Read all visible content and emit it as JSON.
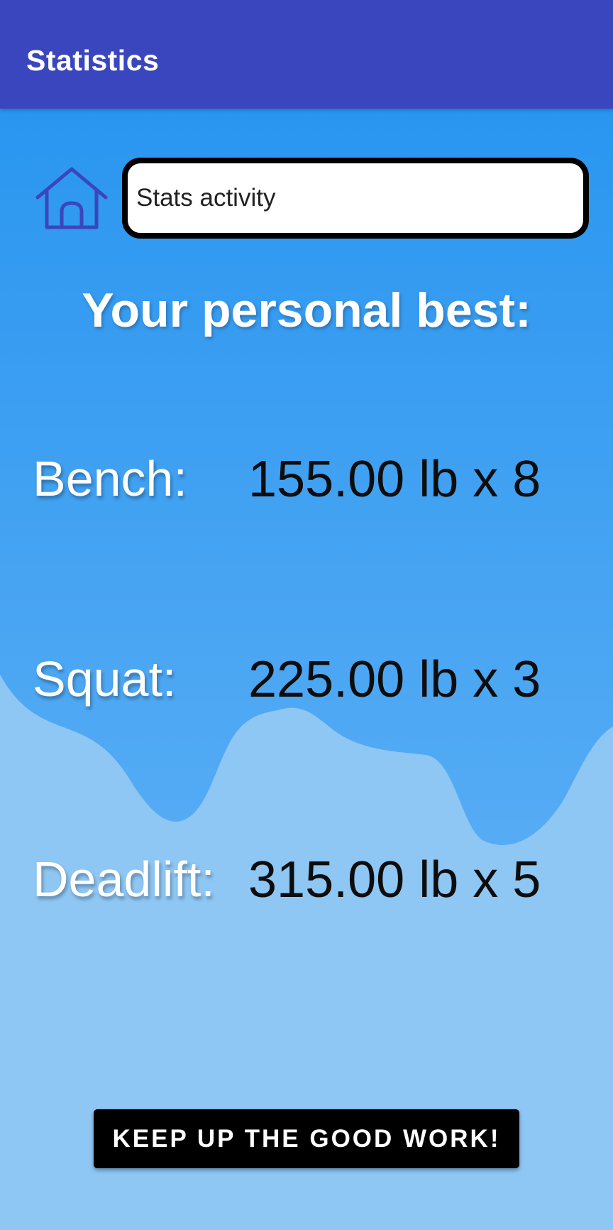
{
  "app_bar": {
    "title": "Statistics",
    "color": "#3a46be"
  },
  "search": {
    "value": "Stats activity"
  },
  "home_icon": "home-icon",
  "heading": "Your personal best:",
  "stats": [
    {
      "label": "Bench:",
      "value": "155.00 lb x 8"
    },
    {
      "label": "Squat:",
      "value": "225.00 lb x 3"
    },
    {
      "label": "Deadlift:",
      "value": "315.00 lb x 5"
    }
  ],
  "cta": {
    "label": "KEEP UP THE GOOD WORK!"
  },
  "colors": {
    "background_top": "#2a96f0",
    "background_bottom": "#5fb0f5",
    "wave": "#8ec6f4",
    "button": "#000000"
  }
}
